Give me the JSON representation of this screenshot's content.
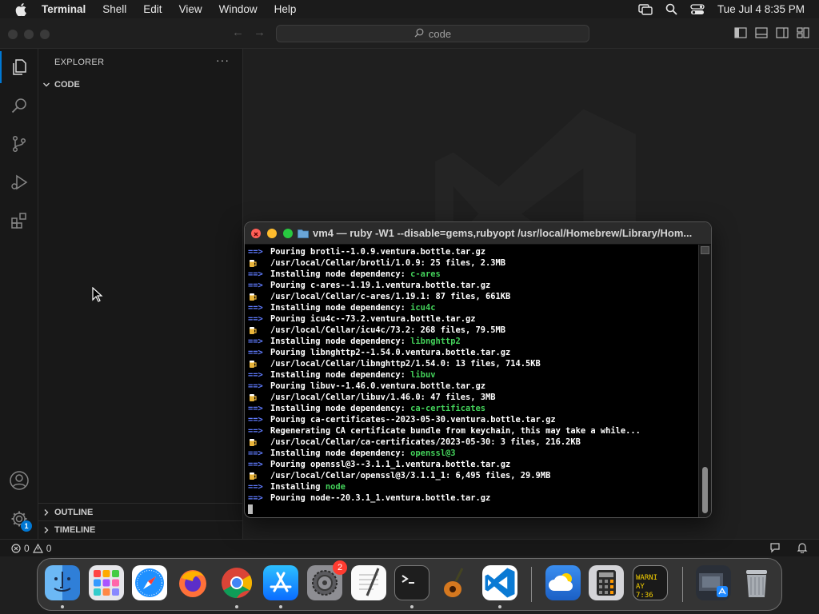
{
  "menubar": {
    "app_name": "Terminal",
    "items": [
      "Shell",
      "Edit",
      "View",
      "Window",
      "Help"
    ],
    "datetime": "Tue Jul 4  8:35 PM"
  },
  "titlebar": {
    "search_text": "code"
  },
  "sidebar": {
    "title": "EXPLORER",
    "more": "···",
    "folder": "CODE",
    "outline": "OUTLINE",
    "timeline": "TIMELINE"
  },
  "activitybar": {
    "icons": [
      "files-icon",
      "search-icon",
      "source-control-icon",
      "run-debug-icon",
      "extensions-icon",
      "accounts-icon",
      "settings-gear-icon"
    ],
    "settings_badge": "1"
  },
  "statusbar": {
    "errors": "0",
    "warnings": "0"
  },
  "terminal": {
    "title": "vm4 — ruby -W1 --disable=gems,rubyopt /usr/local/Homebrew/Library/Hom...",
    "lines": [
      {
        "kind": "arrow",
        "text": "Pouring brotli--1.0.9.ventura.bottle.tar.gz",
        "green": ""
      },
      {
        "kind": "beer",
        "text": "/usr/local/Cellar/brotli/1.0.9: 25 files, 2.3MB",
        "green": ""
      },
      {
        "kind": "arrow",
        "text": "Installing node dependency: ",
        "green": "c-ares"
      },
      {
        "kind": "arrow",
        "text": "Pouring c-ares--1.19.1.ventura.bottle.tar.gz",
        "green": ""
      },
      {
        "kind": "beer",
        "text": "/usr/local/Cellar/c-ares/1.19.1: 87 files, 661KB",
        "green": ""
      },
      {
        "kind": "arrow",
        "text": "Installing node dependency: ",
        "green": "icu4c"
      },
      {
        "kind": "arrow",
        "text": "Pouring icu4c--73.2.ventura.bottle.tar.gz",
        "green": ""
      },
      {
        "kind": "beer",
        "text": "/usr/local/Cellar/icu4c/73.2: 268 files, 79.5MB",
        "green": ""
      },
      {
        "kind": "arrow",
        "text": "Installing node dependency: ",
        "green": "libnghttp2"
      },
      {
        "kind": "arrow",
        "text": "Pouring libnghttp2--1.54.0.ventura.bottle.tar.gz",
        "green": ""
      },
      {
        "kind": "beer",
        "text": "/usr/local/Cellar/libnghttp2/1.54.0: 13 files, 714.5KB",
        "green": ""
      },
      {
        "kind": "arrow",
        "text": "Installing node dependency: ",
        "green": "libuv"
      },
      {
        "kind": "arrow",
        "text": "Pouring libuv--1.46.0.ventura.bottle.tar.gz",
        "green": ""
      },
      {
        "kind": "beer",
        "text": "/usr/local/Cellar/libuv/1.46.0: 47 files, 3MB",
        "green": ""
      },
      {
        "kind": "arrow",
        "text": "Installing node dependency: ",
        "green": "ca-certificates"
      },
      {
        "kind": "arrow",
        "text": "Pouring ca-certificates--2023-05-30.ventura.bottle.tar.gz",
        "green": ""
      },
      {
        "kind": "arrow",
        "text": "Regenerating CA certificate bundle from keychain, this may take a while...",
        "green": ""
      },
      {
        "kind": "beer",
        "text": "/usr/local/Cellar/ca-certificates/2023-05-30: 3 files, 216.2KB",
        "green": ""
      },
      {
        "kind": "arrow",
        "text": "Installing node dependency: ",
        "green": "openssl@3"
      },
      {
        "kind": "arrow",
        "text": "Pouring openssl@3--3.1.1_1.ventura.bottle.tar.gz",
        "green": ""
      },
      {
        "kind": "beer",
        "text": "/usr/local/Cellar/openssl@3/3.1.1_1: 6,495 files, 29.9MB",
        "green": ""
      },
      {
        "kind": "arrow",
        "text": "Installing ",
        "green": "node"
      },
      {
        "kind": "arrow",
        "text": "Pouring node--20.3.1_1.ventura.bottle.tar.gz",
        "green": ""
      }
    ],
    "arrow_glyph": "==>"
  },
  "dock": {
    "apps": [
      "Finder",
      "Launchpad",
      "Safari",
      "Firefox",
      "Chrome",
      "App Store",
      "System Settings",
      "TextEdit",
      "Terminal",
      "GarageBand",
      "Visual Studio Code",
      "Weather",
      "Calculator",
      "Console",
      "Downloads",
      "Trash"
    ],
    "settings_badge": "2",
    "console_text_1": "WARNI",
    "console_text_2": "AY 7:36"
  },
  "colors": {
    "accent": "#0078d4",
    "terminal_arrow": "#5f7bff",
    "terminal_green": "#43d15a",
    "close_red": "#ff5f57",
    "minimize_yellow": "#febc2e",
    "zoom_green": "#28c840"
  }
}
